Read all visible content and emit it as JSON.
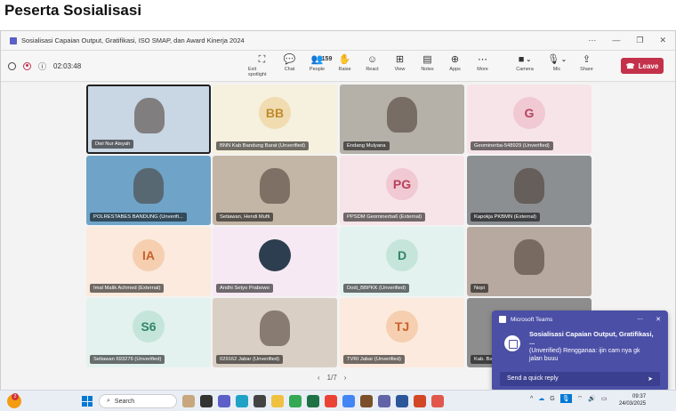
{
  "doc": {
    "title": "Peserta Sosialisasi"
  },
  "window": {
    "title": "Sosialisasi Capaian Output, Gratifikasi, ISO SMAP, dan Award Kinerja 2024"
  },
  "toolbar": {
    "timer": "02:03:48",
    "tools": [
      {
        "label": "Exit spotlight",
        "icon": "⛶"
      },
      {
        "label": "Chat",
        "icon": "💬"
      },
      {
        "label": "People",
        "icon": "👥",
        "count": "159"
      },
      {
        "label": "Raise",
        "icon": "✋"
      },
      {
        "label": "React",
        "icon": "☺"
      },
      {
        "label": "View",
        "icon": "⊞"
      },
      {
        "label": "Notes",
        "icon": "▤"
      },
      {
        "label": "Apps",
        "icon": "⊕"
      },
      {
        "label": "More",
        "icon": "⋯"
      }
    ],
    "camera": "Camera",
    "mic": "Mic",
    "share": "Share",
    "leave": "Leave"
  },
  "participants": [
    {
      "name": "Dwi Nur Aisyah",
      "bg": "#c9d6e3",
      "type": "video"
    },
    {
      "name": "BNN Kab Bandung Barat (Unverified)",
      "bg": "#f6f0de",
      "type": "avatar",
      "initials": "BB",
      "color": "#c08a2c",
      "circle": "#f0dcb0"
    },
    {
      "name": "Endang Mulyana",
      "bg": "#b5b0a8",
      "type": "video"
    },
    {
      "name": "Geominerba-548929 (Unverified)",
      "bg": "#f7e4e8",
      "type": "avatar",
      "initials": "G",
      "color": "#b7415b",
      "circle": "#f0c9d2"
    },
    {
      "name": "POLRESTABES BANDUNG (Unverifi...",
      "bg": "#6fa4c8",
      "type": "video"
    },
    {
      "name": "Setiawan, Hendi Mufti",
      "bg": "#c4b6a6",
      "type": "video"
    },
    {
      "name": "PPSDM Geominerba6 (External)",
      "bg": "#f7e4e8",
      "type": "avatar",
      "initials": "PG",
      "color": "#b7415b",
      "circle": "#f0c9d2"
    },
    {
      "name": "Kapokja PKBMN (External)",
      "bg": "#8c8f92",
      "type": "video"
    },
    {
      "name": "Imal Malik Achmed (External)",
      "bg": "#fbeadd",
      "type": "avatar",
      "initials": "IA",
      "color": "#c8612a",
      "circle": "#f5cfb0"
    },
    {
      "name": "Andhi Setyo Prabowo",
      "bg": "#f7e9f3",
      "type": "avatar",
      "initials": "",
      "color": "#333",
      "circle": "#2c3e50"
    },
    {
      "name": "Dodi_BBPKK (Unverified)",
      "bg": "#e3f2ee",
      "type": "avatar",
      "initials": "D",
      "color": "#2e8567",
      "circle": "#c5e5da"
    },
    {
      "name": "Nopi",
      "bg": "#b7a9a0",
      "type": "video"
    },
    {
      "name": "Setiawan 693276 (Unverified)",
      "bg": "#e3f2ee",
      "type": "avatar",
      "initials": "S6",
      "color": "#2e8567",
      "circle": "#c5e5da"
    },
    {
      "name": "029162 Jabar (Unverified)",
      "bg": "#d9cfc4",
      "type": "video"
    },
    {
      "name": "TVRI Jabar (Unverified)",
      "bg": "#fbeadd",
      "type": "avatar",
      "initials": "TJ",
      "color": "#c8612a",
      "circle": "#f5cfb0"
    },
    {
      "name": "Kab. Bandung (Unverified)",
      "bg": "#8d8d8d",
      "type": "video"
    }
  ],
  "pager": {
    "prev": "‹",
    "label": "1/7",
    "next": "›"
  },
  "toast": {
    "app": "Microsoft Teams",
    "title": "Sosialisasi Capaian Output, Gratifikasi, ...",
    "message": "(Unverified) Rengganaa: ijin cam nya gk jalan buuu",
    "reply_placeholder": "Send a quick reply"
  },
  "taskbar": {
    "search": "Search",
    "time": "09:37",
    "date": "24/03/2025",
    "badge": "2"
  }
}
